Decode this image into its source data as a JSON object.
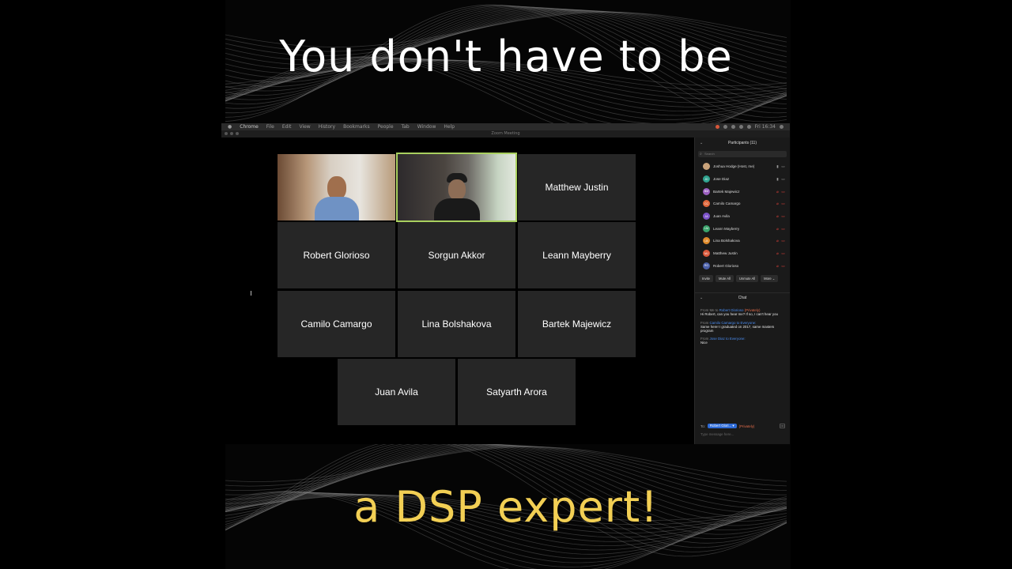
{
  "caption": {
    "top": "You don't have to be",
    "bottom": "a DSP expert!"
  },
  "colors": {
    "caption_top": "#ffffff",
    "caption_bottom": "#f2cf54",
    "active_speaker_outline": "#a9d05f",
    "tile_bg": "#262626",
    "link_blue": "#4a8cf0",
    "private_orange": "#e06b4a",
    "mute_red": "#e0413a"
  },
  "menubar": {
    "app": "Chrome",
    "items": [
      "File",
      "Edit",
      "View",
      "History",
      "Bookmarks",
      "People",
      "Tab",
      "Window",
      "Help"
    ],
    "clock": "Fri 16:34"
  },
  "window": {
    "title": "Zoom Meeting"
  },
  "gallery": {
    "tiles": [
      {
        "name": "",
        "video": true,
        "active": false
      },
      {
        "name": "",
        "video": true,
        "active": true
      },
      {
        "name": "Matthew Justin"
      },
      {
        "name": "Robert Glorioso"
      },
      {
        "name": "Sorgun Akkor"
      },
      {
        "name": "Leann Mayberry"
      },
      {
        "name": "Camilo Camargo"
      },
      {
        "name": "Lina Bolshakova"
      },
      {
        "name": "Bartek Majewicz"
      },
      {
        "name": "Juan Avila"
      },
      {
        "name": "Satyarth Arora"
      }
    ]
  },
  "participants": {
    "title": "Participants (11)",
    "search_placeholder": "Search",
    "list": [
      {
        "initials": "",
        "name": "Joshua Hodge (Host, me)",
        "color": "#c9a27a",
        "mic": "on",
        "cam": "on"
      },
      {
        "initials": "JD",
        "name": "Jose Diaz",
        "color": "#2fa38f",
        "mic": "on",
        "cam": "on"
      },
      {
        "initials": "BM",
        "name": "Bartek Majewicz",
        "color": "#9b5fc0",
        "mic": "off",
        "cam": "off"
      },
      {
        "initials": "CC",
        "name": "Camilo Camargo",
        "color": "#e0663a",
        "mic": "off",
        "cam": "off"
      },
      {
        "initials": "JA",
        "name": "Juan Avila",
        "color": "#7b52c8",
        "mic": "off",
        "cam": "off"
      },
      {
        "initials": "LM",
        "name": "Leann Mayberry",
        "color": "#3aa36b",
        "mic": "off",
        "cam": "off"
      },
      {
        "initials": "LB",
        "name": "Lina Bolshakova",
        "color": "#e08a2a",
        "mic": "off",
        "cam": "off"
      },
      {
        "initials": "MJ",
        "name": "Matthew Justin",
        "color": "#d9573a",
        "mic": "off",
        "cam": "off"
      },
      {
        "initials": "RG",
        "name": "Robert Glorioso",
        "color": "#4a5fa8",
        "mic": "off",
        "cam": "off"
      }
    ],
    "buttons": [
      "Invite",
      "Mute All",
      "Unmute All",
      "More ⌄"
    ]
  },
  "chat": {
    "title": "Chat",
    "messages": [
      {
        "from_prefix": "From Me to",
        "from_target": "Robert Glorioso",
        "private": "(Privately)",
        "body": "Hi Robert, can you hear me?  If so, I can't hear you"
      },
      {
        "from_prefix": "From",
        "from_target": "Camilo Camargo to Everyone:",
        "private": "",
        "body": "Same here! I graduated on 2017, same masters program"
      },
      {
        "from_prefix": "From",
        "from_target": "Jose Diaz to Everyone:",
        "private": "",
        "body": "Nice"
      }
    ],
    "to_label": "To:",
    "to_recipient": "Robert Glori... ▾",
    "to_private": "(Privately)",
    "more_label": "•••",
    "input_placeholder": "Type message here..."
  }
}
